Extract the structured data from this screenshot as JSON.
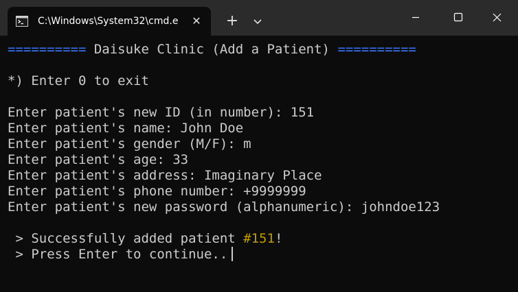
{
  "window": {
    "tab_title": "C:\\Windows\\System32\\cmd.e",
    "new_tab_label": "+",
    "tab_close_label": "✕"
  },
  "terminal": {
    "header_left": "==========",
    "header_title": " Daisuke Clinic (Add a Patient) ",
    "header_right": "==========",
    "exit_hint": "*) Enter 0 to exit",
    "prompts": [
      "Enter patient's new ID (in number): 151",
      "Enter patient's name: John Doe",
      "Enter patient's gender (M/F): m",
      "Enter patient's age: 33",
      "Enter patient's address: Imaginary Place",
      "Enter patient's phone number: +9999999",
      "Enter patient's new password (alphanumeric): johndoe123"
    ],
    "success_prefix": " > Successfully added patient ",
    "success_id": "#151",
    "success_suffix": "!",
    "continue_text": " > Press Enter to continue.."
  },
  "colors": {
    "header": "#3b78ff",
    "highlight": "#c19c00",
    "text": "#cccccc",
    "background": "#0c0c0c"
  }
}
